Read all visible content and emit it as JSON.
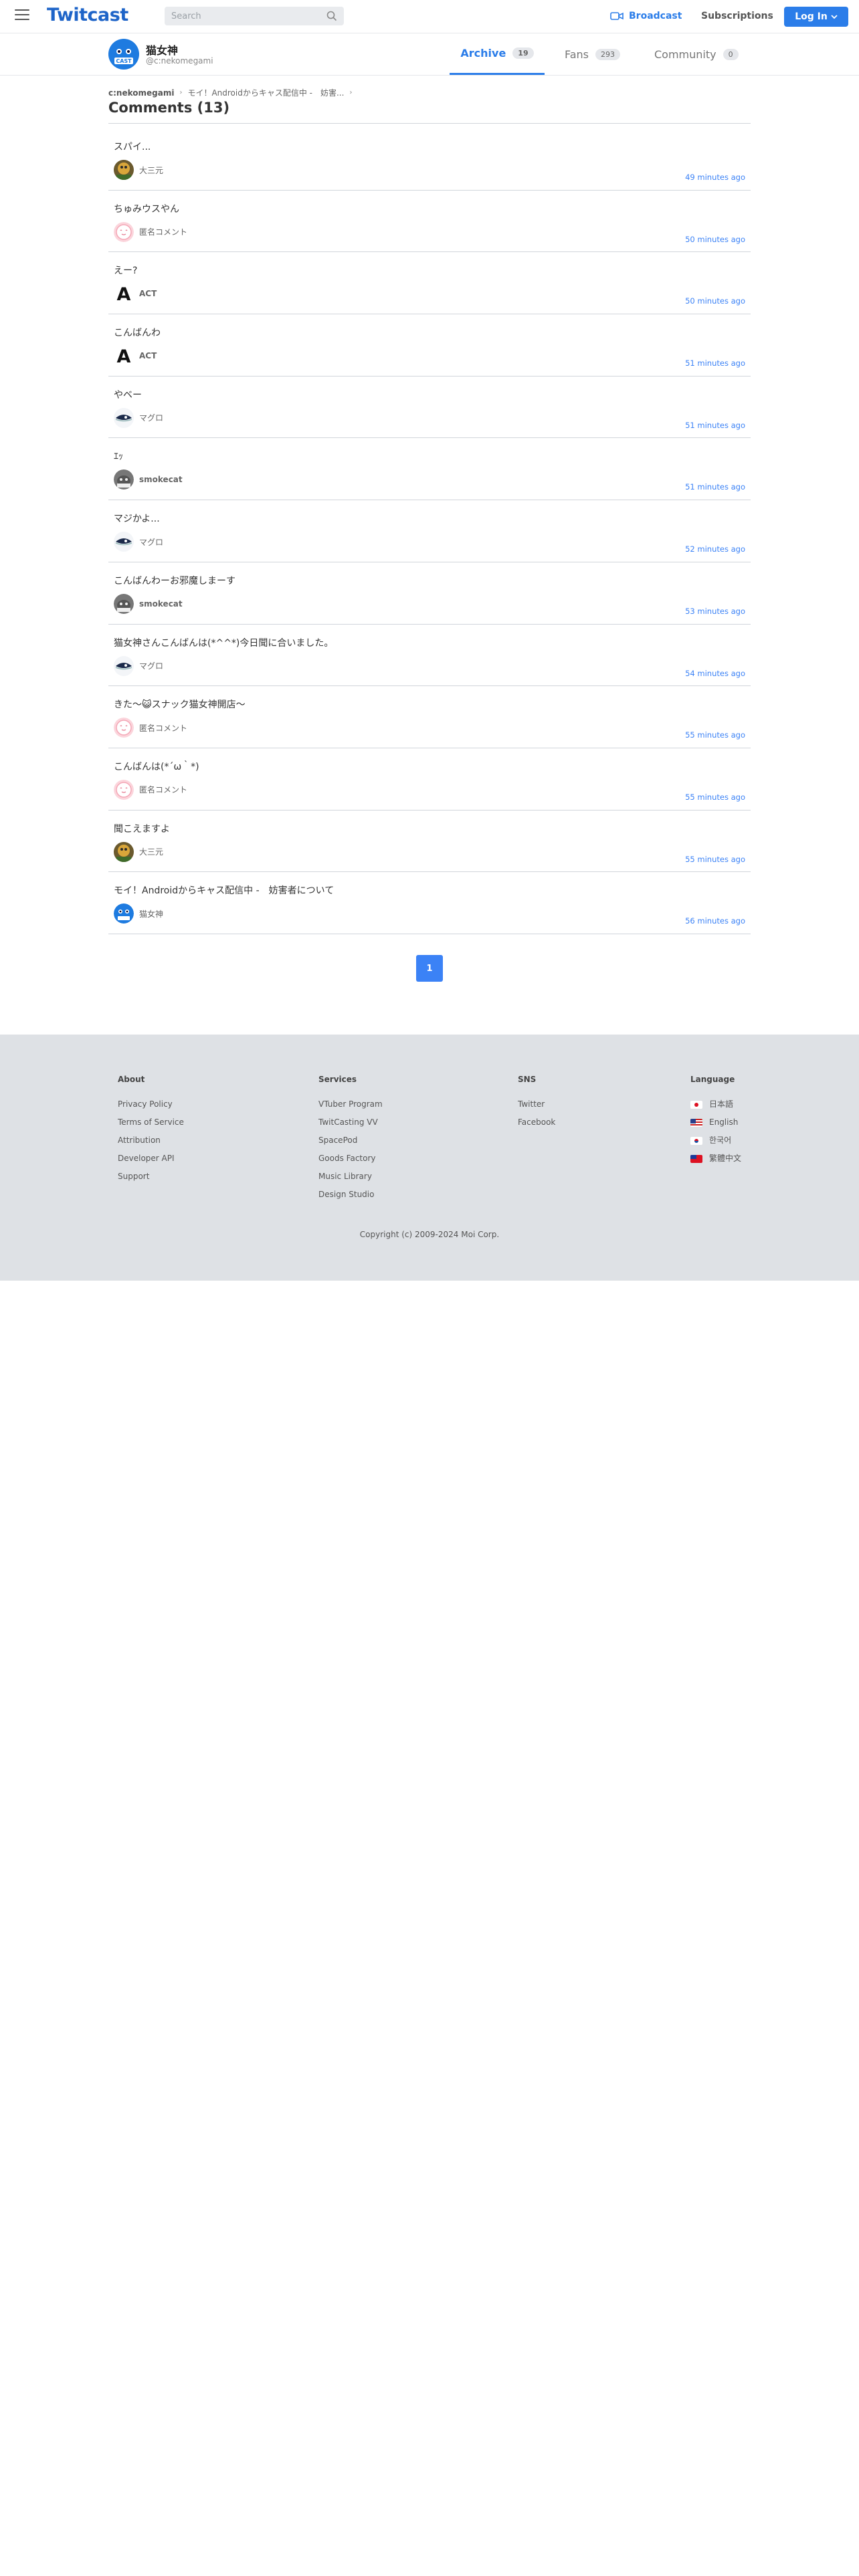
{
  "nav": {
    "logo": "Twitcast",
    "search_placeholder": "Search",
    "broadcast": "Broadcast",
    "subscriptions": "Subscriptions",
    "login": "Log In"
  },
  "profile": {
    "name": "猫女神",
    "handle": "@c:nekomegami",
    "avatar_label": "CAST",
    "tabs": [
      {
        "label": "Archive",
        "count": "19"
      },
      {
        "label": "Fans",
        "count": "293"
      },
      {
        "label": "Community",
        "count": "0"
      }
    ]
  },
  "breadcrumb": {
    "items": [
      "c:nekomegami",
      "モイ！Androidからキャス配信中 -　妨害..."
    ]
  },
  "comments_heading": "Comments (13)",
  "comments": [
    {
      "text": "スパイ...",
      "user": "大三元",
      "time": "49 minutes ago"
    },
    {
      "text": "ちゅみウスやん",
      "user": "匿名コメント",
      "time": "50 minutes ago"
    },
    {
      "text": "えー?",
      "user": "ACT",
      "time": "50 minutes ago"
    },
    {
      "text": "こんばんわ",
      "user": "ACT",
      "time": "51 minutes ago"
    },
    {
      "text": "やベー",
      "user": "マグロ",
      "time": "51 minutes ago"
    },
    {
      "text": "ｴｯ",
      "user": "smokecat",
      "time": "51 minutes ago"
    },
    {
      "text": "マジかよ...",
      "user": "マグロ",
      "time": "52 minutes ago"
    },
    {
      "text": "こんばんわーお邪魔しまーす",
      "user": "smokecat",
      "time": "53 minutes ago"
    },
    {
      "text": "猫女神さんこんばんは(*^^*)今日聞に合いました。",
      "user": "マグロ",
      "time": "54 minutes ago"
    },
    {
      "text": "きた〜😺スナック猫女神開店〜",
      "user": "匿名コメント",
      "time": "55 minutes ago"
    },
    {
      "text": "こんばんは(*´ω｀*)",
      "user": "匿名コメント",
      "time": "55 minutes ago"
    },
    {
      "text": "聞こえますよ",
      "user": "大三元",
      "time": "55 minutes ago"
    },
    {
      "text": "モイ！Androidからキャス配信中 -　妨害者について",
      "user": "猫女神",
      "time": "56 minutes ago"
    }
  ],
  "pagination": {
    "current": "1"
  },
  "footer": {
    "about": {
      "title": "About",
      "links": [
        "Privacy Policy",
        "Terms of Service",
        "Attribution",
        "Developer API",
        "Support"
      ]
    },
    "services": {
      "title": "Services",
      "links": [
        "VTuber Program",
        "TwitCasting VV",
        "SpacePod",
        "Goods Factory",
        "Music Library",
        "Design Studio"
      ]
    },
    "sns": {
      "title": "SNS",
      "links": [
        "Twitter",
        "Facebook"
      ]
    },
    "language": {
      "title": "Language",
      "links": [
        "日本語",
        "English",
        "한국어",
        "繁體中文"
      ]
    },
    "copyright": "Copyright (c) 2009-2024 Moi Corp."
  },
  "colors": {
    "accent": "#2b7de9",
    "footer_bg": "#dee1e5",
    "time": "#3b82f6"
  }
}
